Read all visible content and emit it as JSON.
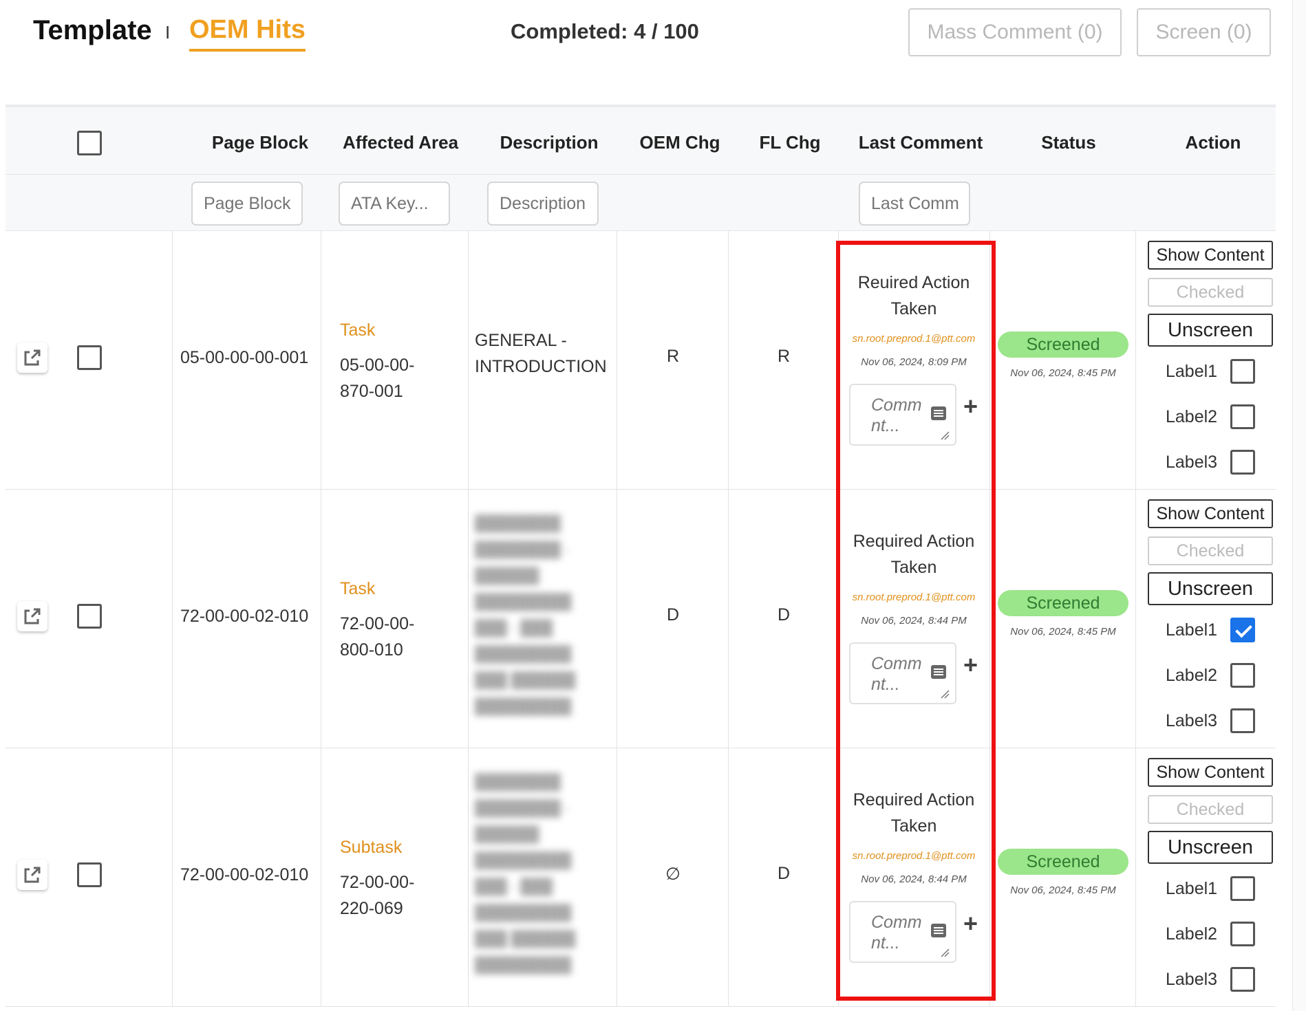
{
  "header": {
    "title": "Template",
    "separator": "I",
    "active_tab": "OEM Hits",
    "completed": "Completed: 4 / 100",
    "mass_comment_label": "Mass Comment (0)",
    "screen_label": "Screen (0)"
  },
  "columns": {
    "page_block": "Page Block",
    "affected_area": "Affected Area",
    "description": "Description",
    "oem_chg": "OEM Chg",
    "fl_chg": "FL Chg",
    "last_comment": "Last Comment",
    "status": "Status",
    "action": "Action"
  },
  "filters": {
    "page_block": "Page Block",
    "ata_key": "ATA Key...",
    "description": "Description",
    "last_comment": "Last Comm"
  },
  "rows": [
    {
      "page_block": "05-00-00-00-001",
      "area_type": "Task",
      "area_line1": "05-00-00-",
      "area_line2": "870-001",
      "desc_line1": "GENERAL -",
      "desc_line2": "INTRODUCTION",
      "oem_chg": "R",
      "fl_chg": "R",
      "comment_line1": "Reuired Action",
      "comment_line2": "Taken",
      "comment_user": "sn.root.preprod.1@ptt.com",
      "comment_date": "Nov 06, 2024, 8:09 PM",
      "comment_placeholder": "Comm nt...",
      "status": "Screened",
      "status_date": "Nov 06, 2024, 8:45 PM",
      "labels": [
        {
          "text": "Label1",
          "checked": false
        },
        {
          "text": "Label2",
          "checked": false
        },
        {
          "text": "Label3",
          "checked": false
        }
      ]
    },
    {
      "page_block": "72-00-00-02-010",
      "area_type": "Task",
      "area_line1": "72-00-00-",
      "area_line2": "800-010",
      "oem_chg": "D",
      "fl_chg": "D",
      "comment_line1": "Required Action",
      "comment_line2": "Taken",
      "comment_user": "sn.root.preprod.1@ptt.com",
      "comment_date": "Nov 06, 2024, 8:44 PM",
      "comment_placeholder": "Comm nt...",
      "status": "Screened",
      "status_date": "Nov 06, 2024, 8:45 PM",
      "labels": [
        {
          "text": "Label1",
          "checked": true
        },
        {
          "text": "Label2",
          "checked": false
        },
        {
          "text": "Label3",
          "checked": false
        }
      ]
    },
    {
      "page_block": "72-00-00-02-010",
      "area_type": "Subtask",
      "area_line1": "72-00-00-",
      "area_line2": "220-069",
      "oem_chg": "∅",
      "fl_chg": "D",
      "comment_line1": "Required Action",
      "comment_line2": "Taken",
      "comment_user": "sn.root.preprod.1@ptt.com",
      "comment_date": "Nov 06, 2024, 8:44 PM",
      "comment_placeholder": "Comm nt...",
      "status": "Screened",
      "status_date": "Nov 06, 2024, 8:45 PM",
      "labels": [
        {
          "text": "Label1",
          "checked": false
        },
        {
          "text": "Label2",
          "checked": false
        },
        {
          "text": "Label3",
          "checked": false
        }
      ]
    }
  ],
  "actions": {
    "show_content": "Show Content",
    "checked": "Checked",
    "unscreen": "Unscreen"
  },
  "colors": {
    "accent": "#f0a020",
    "badge": "#9be58a",
    "highlight": "#ee1111",
    "checkbox_checked": "#1a73e8"
  }
}
